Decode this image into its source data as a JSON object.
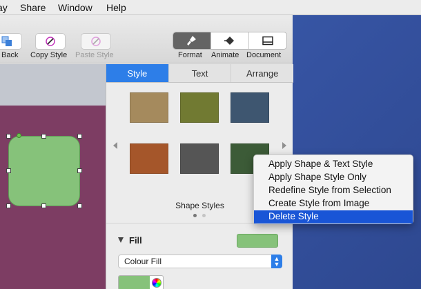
{
  "menubar": {
    "items": [
      "ay",
      "Share",
      "Window",
      "Help"
    ]
  },
  "toolbar": {
    "back_label": "Back",
    "copy_style_label": "Copy Style",
    "paste_style_label": "Paste Style",
    "format_label": "Format",
    "animate_label": "Animate",
    "document_label": "Document"
  },
  "inspector": {
    "tabs": [
      {
        "label": "Style",
        "active": true
      },
      {
        "label": "Text",
        "active": false
      },
      {
        "label": "Arrange",
        "active": false
      }
    ],
    "shape_styles_title": "Shape Styles",
    "swatch_colors": [
      "#a58a5d",
      "#717a32",
      "#3e5670",
      "#a5562a",
      "#555555",
      "#3c5b37"
    ],
    "fill": {
      "title": "Fill",
      "swatch_color": "#86c27a",
      "select_value": "Colour Fill"
    }
  },
  "context_menu": {
    "items": [
      "Apply Shape & Text Style",
      "Apply Shape Style Only",
      "Redefine Style from Selection",
      "Create Style from Image",
      "Delete Style"
    ],
    "highlighted": "Delete Style"
  },
  "colors": {
    "accent": "#2d7ee8",
    "menu_highlight": "#1955d6",
    "slide_background": "#7d3d63",
    "shape_fill": "#86c27a"
  }
}
